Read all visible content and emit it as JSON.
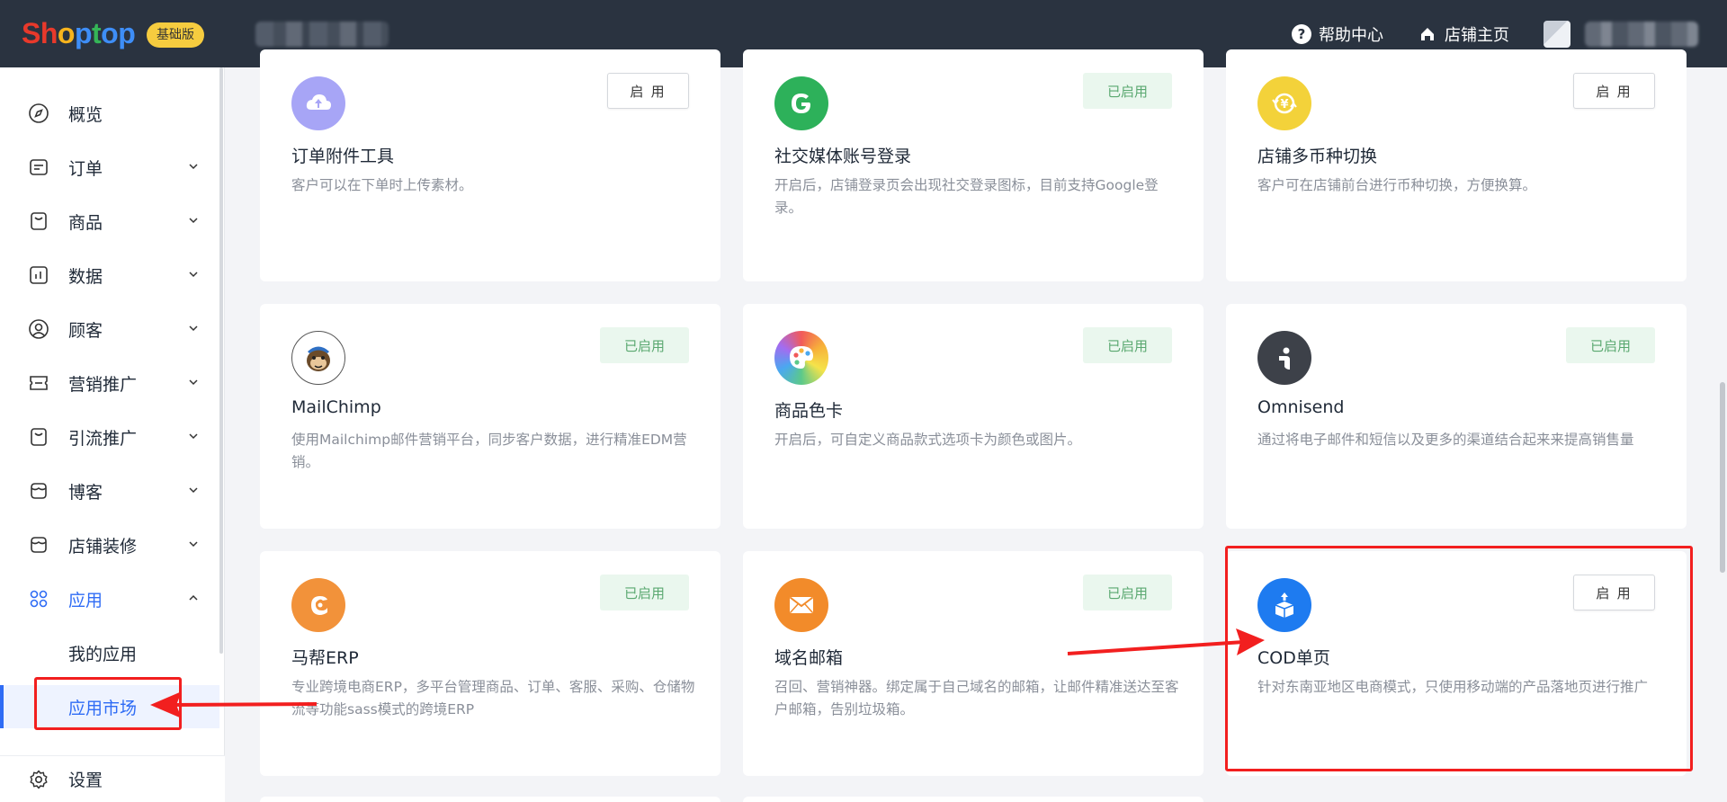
{
  "header": {
    "logo_letters": [
      "S",
      "h",
      "o",
      "p",
      "t",
      "o",
      "p"
    ],
    "logo_colors": [
      "#e8392b",
      "#e8392b",
      "#f7b41d",
      "#3e8ef7",
      "#35b557",
      "#3e8ef7",
      "#3e8ef7"
    ],
    "plan_badge": "基础版",
    "help_label": "帮助中心",
    "store_home_label": "店铺主页"
  },
  "sidebar": {
    "items": [
      {
        "label": "概览",
        "icon": "compass-icon"
      },
      {
        "label": "订单",
        "icon": "order-icon"
      },
      {
        "label": "商品",
        "icon": "bag-icon"
      },
      {
        "label": "数据",
        "icon": "chart-icon"
      },
      {
        "label": "顾客",
        "icon": "user-icon"
      },
      {
        "label": "营销推广",
        "icon": "ticket-icon"
      },
      {
        "label": "引流推广",
        "icon": "bag-icon"
      },
      {
        "label": "博客",
        "icon": "store-icon"
      },
      {
        "label": "店铺装修",
        "icon": "store-icon"
      },
      {
        "label": "应用",
        "icon": "apps-icon"
      }
    ],
    "sub_items": [
      {
        "label": "我的应用"
      },
      {
        "label": "应用市场"
      }
    ],
    "settings_label": "设置",
    "active_color": "#2f6cf5"
  },
  "apps": [
    {
      "title": "订单附件工具",
      "desc": "客户可以在下单时上传素材。",
      "status": "启 用",
      "enabled": false,
      "icon": "cloud-upload-icon"
    },
    {
      "title": "社交媒体账号登录",
      "desc": "开启后，店铺登录页会出现社交登录图标，目前支持Google登录。",
      "status": "已启用",
      "enabled": true,
      "icon": "google-icon"
    },
    {
      "title": "店铺多币种切换",
      "desc": "客户可在店铺前台进行币种切换，方便换算。",
      "status": "启 用",
      "enabled": false,
      "icon": "currency-icon"
    },
    {
      "title": "MailChimp",
      "desc": "使用Mailchimp邮件营销平台，同步客户数据，进行精准EDM营销。",
      "status": "已启用",
      "enabled": true,
      "icon": "mailchimp-icon"
    },
    {
      "title": "商品色卡",
      "desc": "开启后，可自定义商品款式选项卡为颜色或图片。",
      "status": "已启用",
      "enabled": true,
      "icon": "palette-icon"
    },
    {
      "title": "Omnisend",
      "desc": "通过将电子邮件和短信以及更多的渠道结合起来来提高销售量",
      "status": "已启用",
      "enabled": true,
      "icon": "omnisend-icon"
    },
    {
      "title": "马帮ERP",
      "desc": "专业跨境电商ERP，多平台管理商品、订单、客服、采购、仓储物流等功能sass模式的跨境ERP",
      "status": "已启用",
      "enabled": true,
      "icon": "mabang-icon"
    },
    {
      "title": "域名邮箱",
      "desc": "召回、营销神器。绑定属于自己域名的邮箱，让邮件精准送达至客户邮箱，告别垃圾箱。",
      "status": "已启用",
      "enabled": true,
      "icon": "mail-icon"
    },
    {
      "title": "COD单页",
      "desc": "针对东南亚地区电商模式，只使用移动端的产品落地页进行推广",
      "status": "启 用",
      "enabled": false,
      "icon": "cod-box-icon"
    }
  ]
}
